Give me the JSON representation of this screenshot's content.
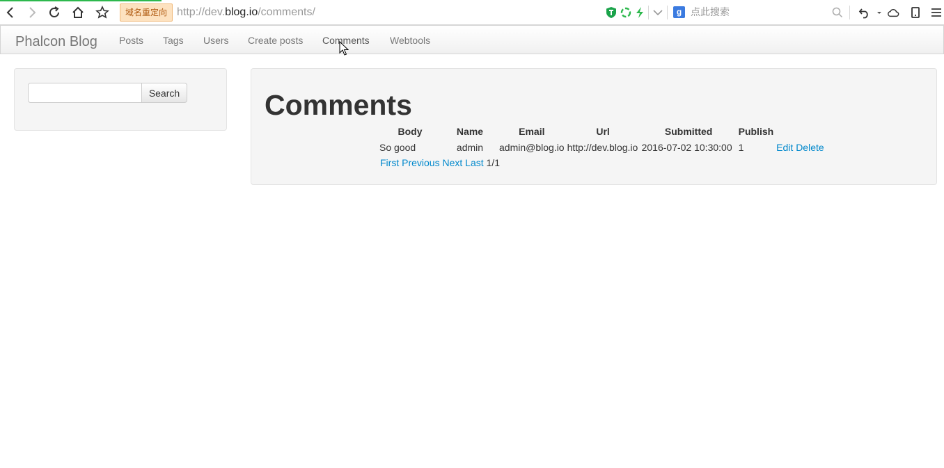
{
  "browser": {
    "redirect_badge": "域名重定向",
    "url_prefix": "http://dev.",
    "url_host": "blog.io",
    "url_path": "/comments/",
    "search_engine_icon": "g",
    "search_placeholder": "点此搜索"
  },
  "navbar": {
    "brand": "Phalcon Blog",
    "links": [
      "Posts",
      "Tags",
      "Users",
      "Create posts",
      "Comments",
      "Webtools"
    ],
    "active": "Comments"
  },
  "sidebar": {
    "search_value": "",
    "search_button": "Search"
  },
  "main": {
    "title": "Comments",
    "table": {
      "headers": [
        "Body",
        "Name",
        "Email",
        "Url",
        "Submitted",
        "Publish"
      ],
      "rows": [
        {
          "body": "So good",
          "name": "admin",
          "email": "admin@blog.io",
          "url": "http://dev.blog.io",
          "submitted": "2016-07-02 10:30:00",
          "publish": "1",
          "edit": "Edit",
          "delete": "Delete"
        }
      ]
    },
    "pagination": {
      "first": "First",
      "previous": "Previous",
      "next": "Next",
      "last": "Last",
      "status": "1/1"
    }
  },
  "colors": {
    "link": "#0088cc",
    "progress": "#2db84d",
    "well_bg": "#f5f5f5"
  }
}
